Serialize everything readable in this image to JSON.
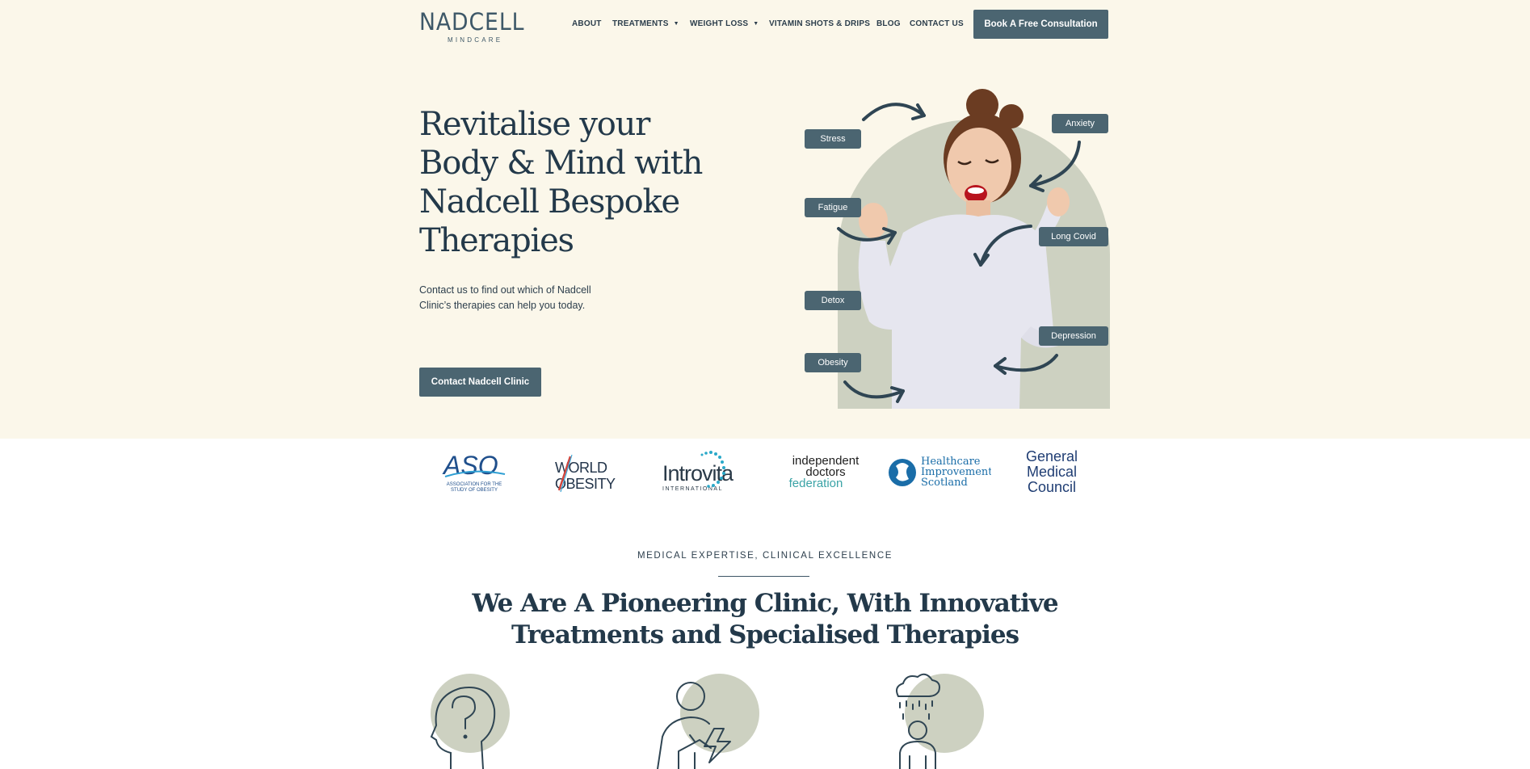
{
  "header": {
    "logo": {
      "main": "NADCELL",
      "sub": "MINDCARE"
    },
    "nav": [
      {
        "label": "ABOUT",
        "has_dropdown": false
      },
      {
        "label": "TREATMENTS",
        "has_dropdown": true
      },
      {
        "label": "WEIGHT LOSS",
        "has_dropdown": true
      },
      {
        "label": "VITAMIN SHOTS & DRIPS",
        "has_dropdown": false
      },
      {
        "label": "BLOG",
        "has_dropdown": false
      },
      {
        "label": "CONTACT US",
        "has_dropdown": false
      }
    ],
    "cta_label": "Book A Free Consultation"
  },
  "hero": {
    "headline_lines": [
      "Revitalise your",
      "Body & Mind with",
      "Nadcell Bespoke",
      "Therapies"
    ],
    "lead": "Contact us to find out which of Nadcell Clinic’s therapies can help you today.",
    "cta_label": "Contact Nadcell Clinic",
    "tags": [
      "Stress",
      "Anxiety",
      "Fatigue",
      "Long Covid",
      "Detox",
      "Depression",
      "Obesity"
    ]
  },
  "partners": {
    "aso": {
      "main": "ASO",
      "sub1": "ASSOCIATION FOR THE",
      "sub2": "STUDY OF OBESITY"
    },
    "world_obesity": {
      "line1": "WORLD",
      "line2": "OBESITY"
    },
    "introvita": {
      "main": "Introvita",
      "sub": "INTERNATIONAL"
    },
    "idf": {
      "line1": "independent",
      "line2": "doctors",
      "line3": "federation"
    },
    "his": {
      "line1": "Healthcare",
      "line2": "Improvement",
      "line3": "Scotland"
    },
    "gmc": {
      "line1": "General",
      "line2": "Medical",
      "line3": "Council"
    }
  },
  "section": {
    "eyebrow": "MEDICAL EXPERTISE, CLINICAL EXCELLENCE",
    "title_lines": [
      "We Are A Pioneering Clinic, With Innovative",
      "Treatments and Specialised Therapies"
    ]
  },
  "colors": {
    "cream": "#fbf7ea",
    "button": "#4b6571",
    "text_dark": "#23394a",
    "sage": "#cdd1c1"
  }
}
